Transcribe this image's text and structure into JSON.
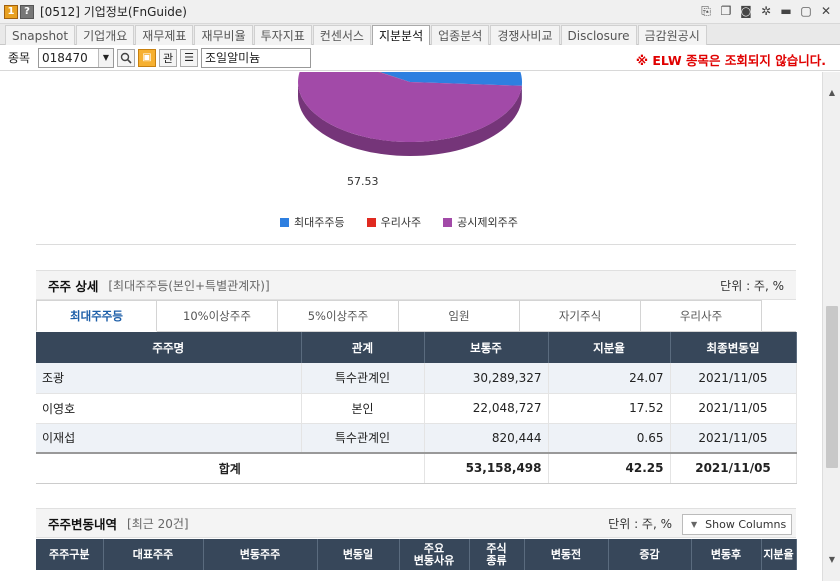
{
  "window": {
    "badge1": "1",
    "badge2": "?",
    "title": "[0512] 기업정보(FnGuide)"
  },
  "tabs": [
    "Snapshot",
    "기업개요",
    "재무제표",
    "재무비율",
    "투자지표",
    "컨센서스",
    "지분분석",
    "업종분석",
    "경쟁사비교",
    "Disclosure",
    "금감원공시"
  ],
  "active_tab": "지분분석",
  "search": {
    "label": "종목",
    "code": "018470",
    "btn_gwan": "관",
    "name": "조일알미늄",
    "warning": "※ ELW 종목은 조회되지 않습니다."
  },
  "chart_data": {
    "type": "pie",
    "title": "",
    "series": [
      {
        "name": "최대주주등",
        "value": 42.25,
        "color": "#2e7fe0"
      },
      {
        "name": "우리사주",
        "value": 0.22,
        "color": "#e02a20"
      },
      {
        "name": "공시제외주주",
        "value": 57.53,
        "color": "#a24aa8"
      }
    ],
    "data_labels": [
      "57.53"
    ],
    "legend_position": "bottom"
  },
  "shareholders_section": {
    "title": "주주 상세",
    "subtitle": "[최대주주등(본인+특별관계자)]",
    "unit": "단위 : 주, %",
    "subtabs": [
      "최대주주등",
      "10%이상주주",
      "5%이상주주",
      "임원",
      "자기주식",
      "우리사주"
    ],
    "columns": [
      "주주명",
      "관계",
      "보통주",
      "지분율",
      "최종변동일"
    ],
    "rows": [
      {
        "name": "조광",
        "relation": "특수관계인",
        "shares": "30,289,327",
        "ratio": "24.07",
        "date": "2021/11/05"
      },
      {
        "name": "이영호",
        "relation": "본인",
        "shares": "22,048,727",
        "ratio": "17.52",
        "date": "2021/11/05"
      },
      {
        "name": "이재섭",
        "relation": "특수관계인",
        "shares": "820,444",
        "ratio": "0.65",
        "date": "2021/11/05"
      }
    ],
    "total": {
      "label": "합계",
      "shares": "53,158,498",
      "ratio": "42.25",
      "date": "2021/11/05"
    }
  },
  "history_section": {
    "title": "주주변동내역",
    "subtitle": "[최근 20건]",
    "unit": "단위 : 주, %",
    "show_columns": "Show Columns",
    "columns": [
      "주주구분",
      "대표주주",
      "변동주주",
      "변동일",
      "주요\n변동사유",
      "주식\n종류",
      "변동전",
      "증감",
      "변동후",
      "지분율"
    ]
  }
}
